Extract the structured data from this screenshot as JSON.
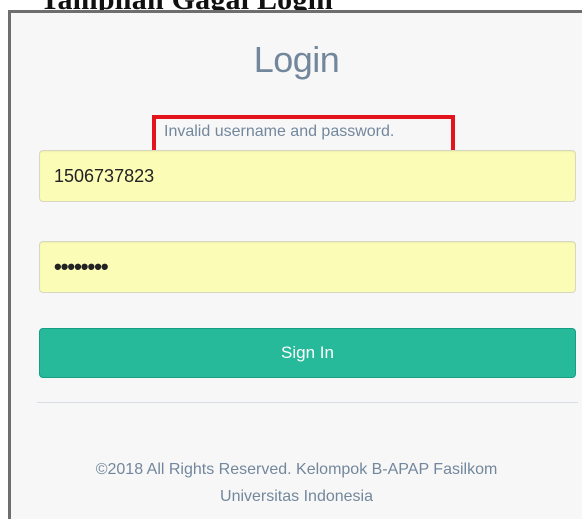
{
  "caption": "Tampilan Gagal Login",
  "login": {
    "title": "Login",
    "error_message": "Invalid username and password.",
    "username_value": "1506737823",
    "password_value": "••••••••",
    "sign_in_label": "Sign In"
  },
  "footer": {
    "line1": "©2018 All Rights Reserved. Kelompok B-APAP Fasilkom",
    "line2": "Universitas Indonesia"
  },
  "colors": {
    "accent": "#26b99a",
    "error_highlight": "#e3141c",
    "autofill_background": "#fbfcb6",
    "muted_text": "#73879c"
  }
}
